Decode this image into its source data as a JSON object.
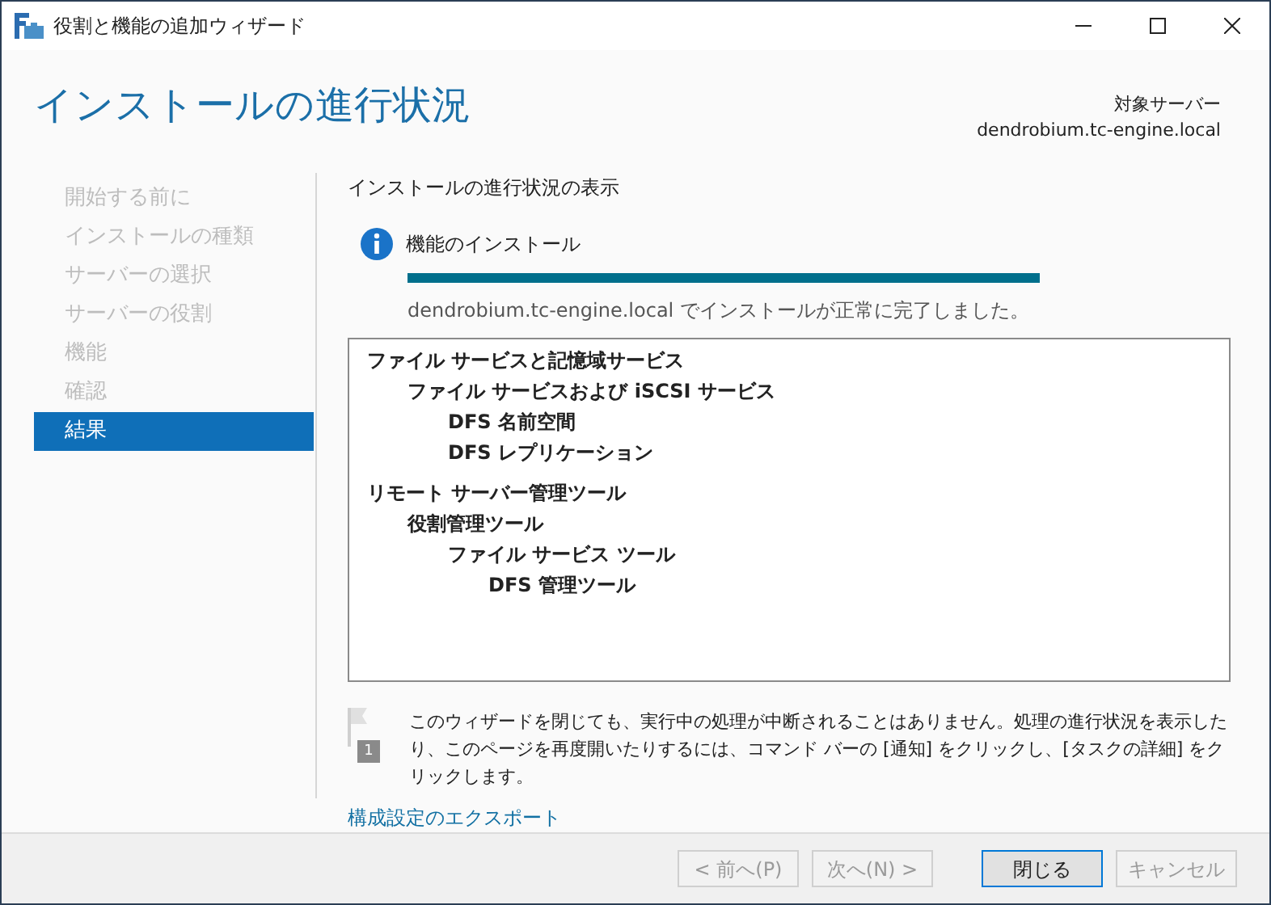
{
  "window": {
    "title": "役割と機能の追加ウィザード"
  },
  "header": {
    "title": "インストールの進行状況",
    "target_label": "対象サーバー",
    "target_server": "dendrobium.tc-engine.local"
  },
  "sidebar": {
    "items": [
      {
        "label": "開始する前に",
        "selected": false,
        "disabled": true
      },
      {
        "label": "インストールの種類",
        "selected": false,
        "disabled": true
      },
      {
        "label": "サーバーの選択",
        "selected": false,
        "disabled": true
      },
      {
        "label": "サーバーの役割",
        "selected": false,
        "disabled": true
      },
      {
        "label": "機能",
        "selected": false,
        "disabled": true
      },
      {
        "label": "確認",
        "selected": false,
        "disabled": true
      },
      {
        "label": "結果",
        "selected": true,
        "disabled": false
      }
    ]
  },
  "content": {
    "heading": "インストールの進行状況の表示",
    "status_title": "機能のインストール",
    "progress": {
      "level": 1
    },
    "status_message": "dendrobium.tc-engine.local でインストールが正常に完了しました。",
    "results": [
      {
        "label": "ファイル サービスと記憶域サービス",
        "children": [
          {
            "label": "ファイル サービスおよび iSCSI サービス",
            "children": [
              {
                "label": "DFS 名前空間"
              },
              {
                "label": "DFS レプリケーション"
              }
            ]
          }
        ]
      },
      {
        "label": "リモート サーバー管理ツール",
        "children": [
          {
            "label": "役割管理ツール",
            "children": [
              {
                "label": "ファイル サービス ツール",
                "children": [
                  {
                    "label": "DFS 管理ツール"
                  }
                ]
              }
            ]
          }
        ]
      }
    ],
    "notice": {
      "badge": "1",
      "text": "このウィザードを閉じても、実行中の処理が中断されることはありません。処理の進行状況を表示したり、このページを再度開いたりするには、コマンド バーの [通知] をクリックし、[タスクの詳細] をクリックします。"
    },
    "export_link": "構成設定のエクスポート"
  },
  "buttons": [
    {
      "label": "< 前へ(P)",
      "disabled": true,
      "default": false
    },
    {
      "label": "次へ(N) >",
      "disabled": true,
      "default": false
    },
    {
      "label": "閉じる",
      "disabled": false,
      "default": true
    },
    {
      "label": "キャンセル",
      "disabled": true,
      "default": false
    }
  ]
}
